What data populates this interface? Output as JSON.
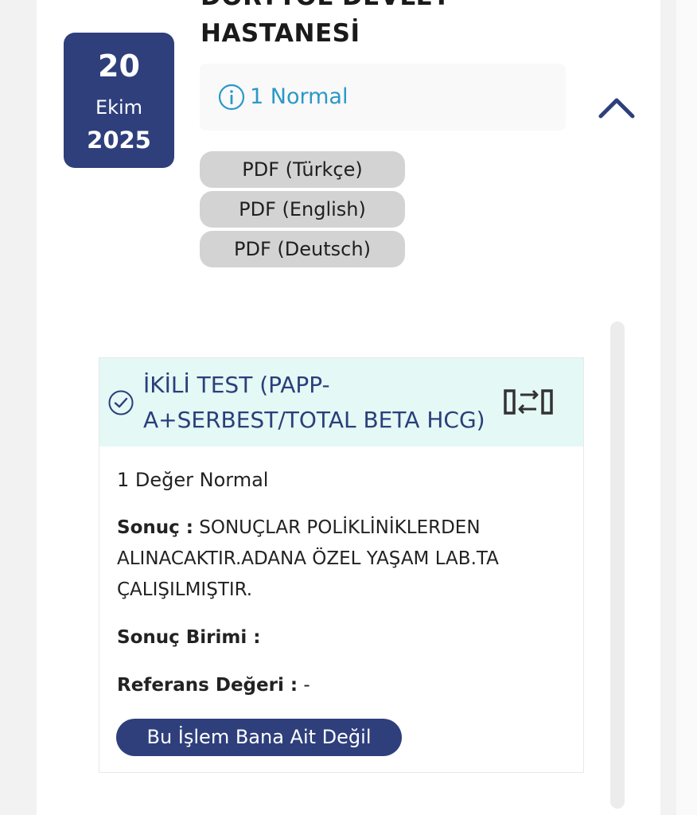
{
  "date": {
    "day": "20",
    "month": "Ekim",
    "year": "2025"
  },
  "hospital": {
    "name_line1": "DÖRTYOL DEVLET",
    "name_line2": "HASTANESİ"
  },
  "status": {
    "text": "1 Normal",
    "color": "#2b98c8"
  },
  "pdf_buttons": [
    {
      "label": "PDF (Türkçe)"
    },
    {
      "label": "PDF (English)"
    },
    {
      "label": "PDF (Deutsch)"
    }
  ],
  "result": {
    "test_name": "İKİLİ TEST (PAPP-A+SERBEST/TOTAL BETA HCG)",
    "normal_count": "1 Değer Normal",
    "sonuc_label": "Sonuç :",
    "sonuc_value": "SONUÇLAR POLİKLİNİKLERDEN ALINACAKTIR.ADANA ÖZEL YAŞAM LAB.TA ÇALIŞILMIŞTIR.",
    "birim_label": "Sonuç Birimi :",
    "birim_value": "",
    "referans_label": "Referans Değeri :",
    "referans_value": "-",
    "not_mine_button": "Bu İşlem Bana Ait Değil"
  },
  "icons": {
    "info": "info-circle-icon",
    "chevron": "chevron-up-icon",
    "check": "check-circle-icon",
    "swap": "swap-arrows-icon"
  },
  "colors": {
    "brand_navy": "#2e3f7c",
    "header_bg": "#e4f8f5",
    "pdf_button_bg": "#d3d3d3"
  }
}
